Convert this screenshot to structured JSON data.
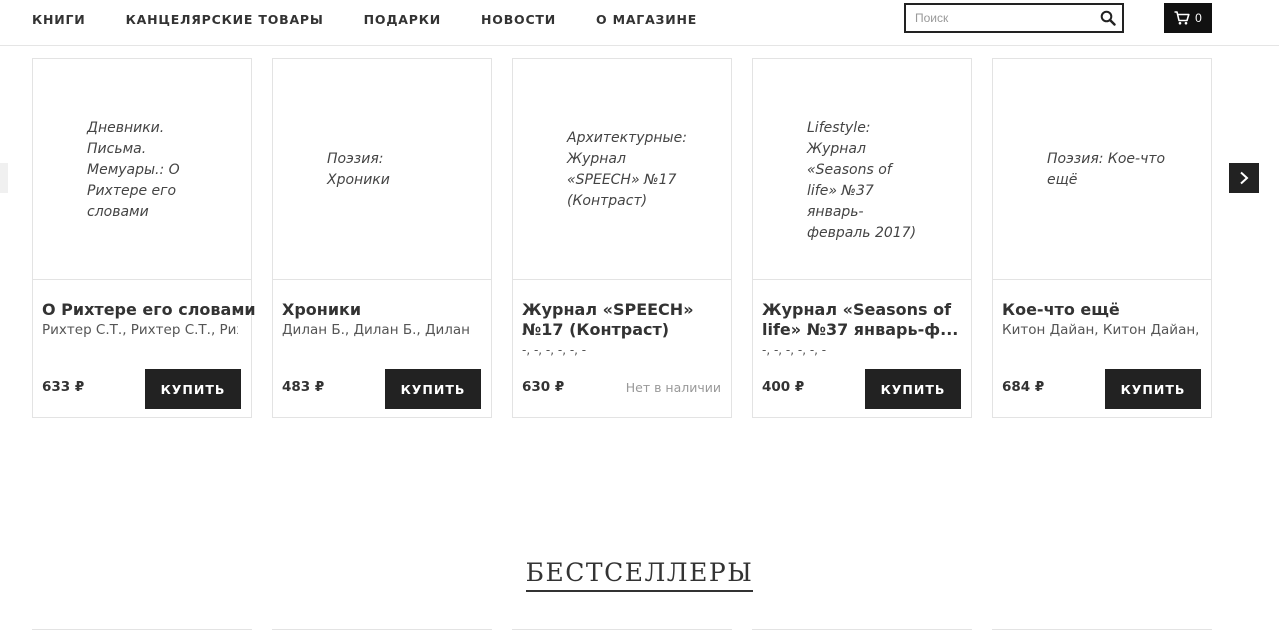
{
  "nav": {
    "items": [
      "КНИГИ",
      "КАНЦЕЛЯРСКИЕ ТОВАРЫ",
      "ПОДАРКИ",
      "НОВОСТИ",
      "О МАГАЗИНЕ"
    ]
  },
  "search": {
    "placeholder": "Поиск",
    "icon": "search-icon"
  },
  "cart": {
    "count": "0",
    "icon": "cart-icon"
  },
  "products": [
    {
      "cover_text": "Дневники. Письма. Мемуары.: О Рихтере его словами",
      "title": "О Рихтере его словами",
      "authors": "Рихтер С.Т., Рихтер С.Т., Рихтер С.Т.",
      "price": "633 ₽",
      "action": "КУПИТЬ"
    },
    {
      "cover_text": "Поэзия: Хроники",
      "title": "Хроники",
      "authors": "Дилан Б., Дилан Б., Дилан Б.",
      "price": "483 ₽",
      "action": "КУПИТЬ"
    },
    {
      "cover_text": "Архитектурные: Журнал «SPEECH» №17 (Контраст)",
      "title": "Журнал «SPEECH» №17 (Контраст)",
      "authors": "-, -, -, -, -, -",
      "price": "630 ₽",
      "status": "Нет в наличии"
    },
    {
      "cover_text": "Lifestyle: Журнал «Seasons of life» №37 январь-февраль 2017)",
      "title": "Журнал «Seasons of life» №37 январь-ф...",
      "authors": "-, -, -, -, -, -",
      "price": "400 ₽",
      "action": "КУПИТЬ"
    },
    {
      "cover_text": "Поэзия: Кое-что ещё",
      "title": "Кое-что ещё",
      "authors": "Китон Дайан, Китон Дайан, Китон Дайан",
      "price": "684 ₽",
      "action": "КУПИТЬ"
    }
  ],
  "bestsellers": {
    "title": "БЕСТСЕЛЛЕРЫ"
  },
  "colors": {
    "accent": "#222222",
    "border": "#e3e3e3",
    "muted": "#999999"
  }
}
